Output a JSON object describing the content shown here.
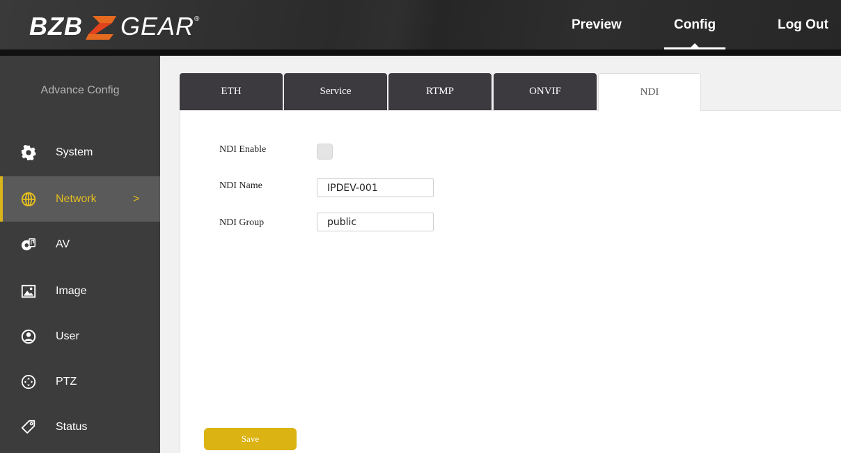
{
  "brand": {
    "left": "BZB",
    "right": "GEAR",
    "registered": "®"
  },
  "topnav": {
    "preview": "Preview",
    "config": "Config",
    "logout": "Log Out"
  },
  "sidebar": {
    "title": "Advance Config",
    "items": [
      {
        "label": "System",
        "icon": "gear-icon"
      },
      {
        "label": "Network",
        "icon": "globe-icon",
        "chevron": ">"
      },
      {
        "label": "AV",
        "icon": "av-icon"
      },
      {
        "label": "Image",
        "icon": "image-icon"
      },
      {
        "label": "User",
        "icon": "user-icon"
      },
      {
        "label": "PTZ",
        "icon": "ptz-icon"
      },
      {
        "label": "Status",
        "icon": "tag-icon"
      }
    ]
  },
  "tabs": [
    "ETH",
    "Service",
    "RTMP",
    "ONVIF",
    "NDI"
  ],
  "form": {
    "ndi_enable_label": "NDI Enable",
    "ndi_name_label": "NDI Name",
    "ndi_name_value": "IPDEV-001",
    "ndi_group_label": "NDI Group",
    "ndi_group_value": "public",
    "save_label": "Save"
  },
  "colors": {
    "accent": "#dbb312",
    "sidebar": "#3c3c3c",
    "tab": "#3c393f"
  }
}
